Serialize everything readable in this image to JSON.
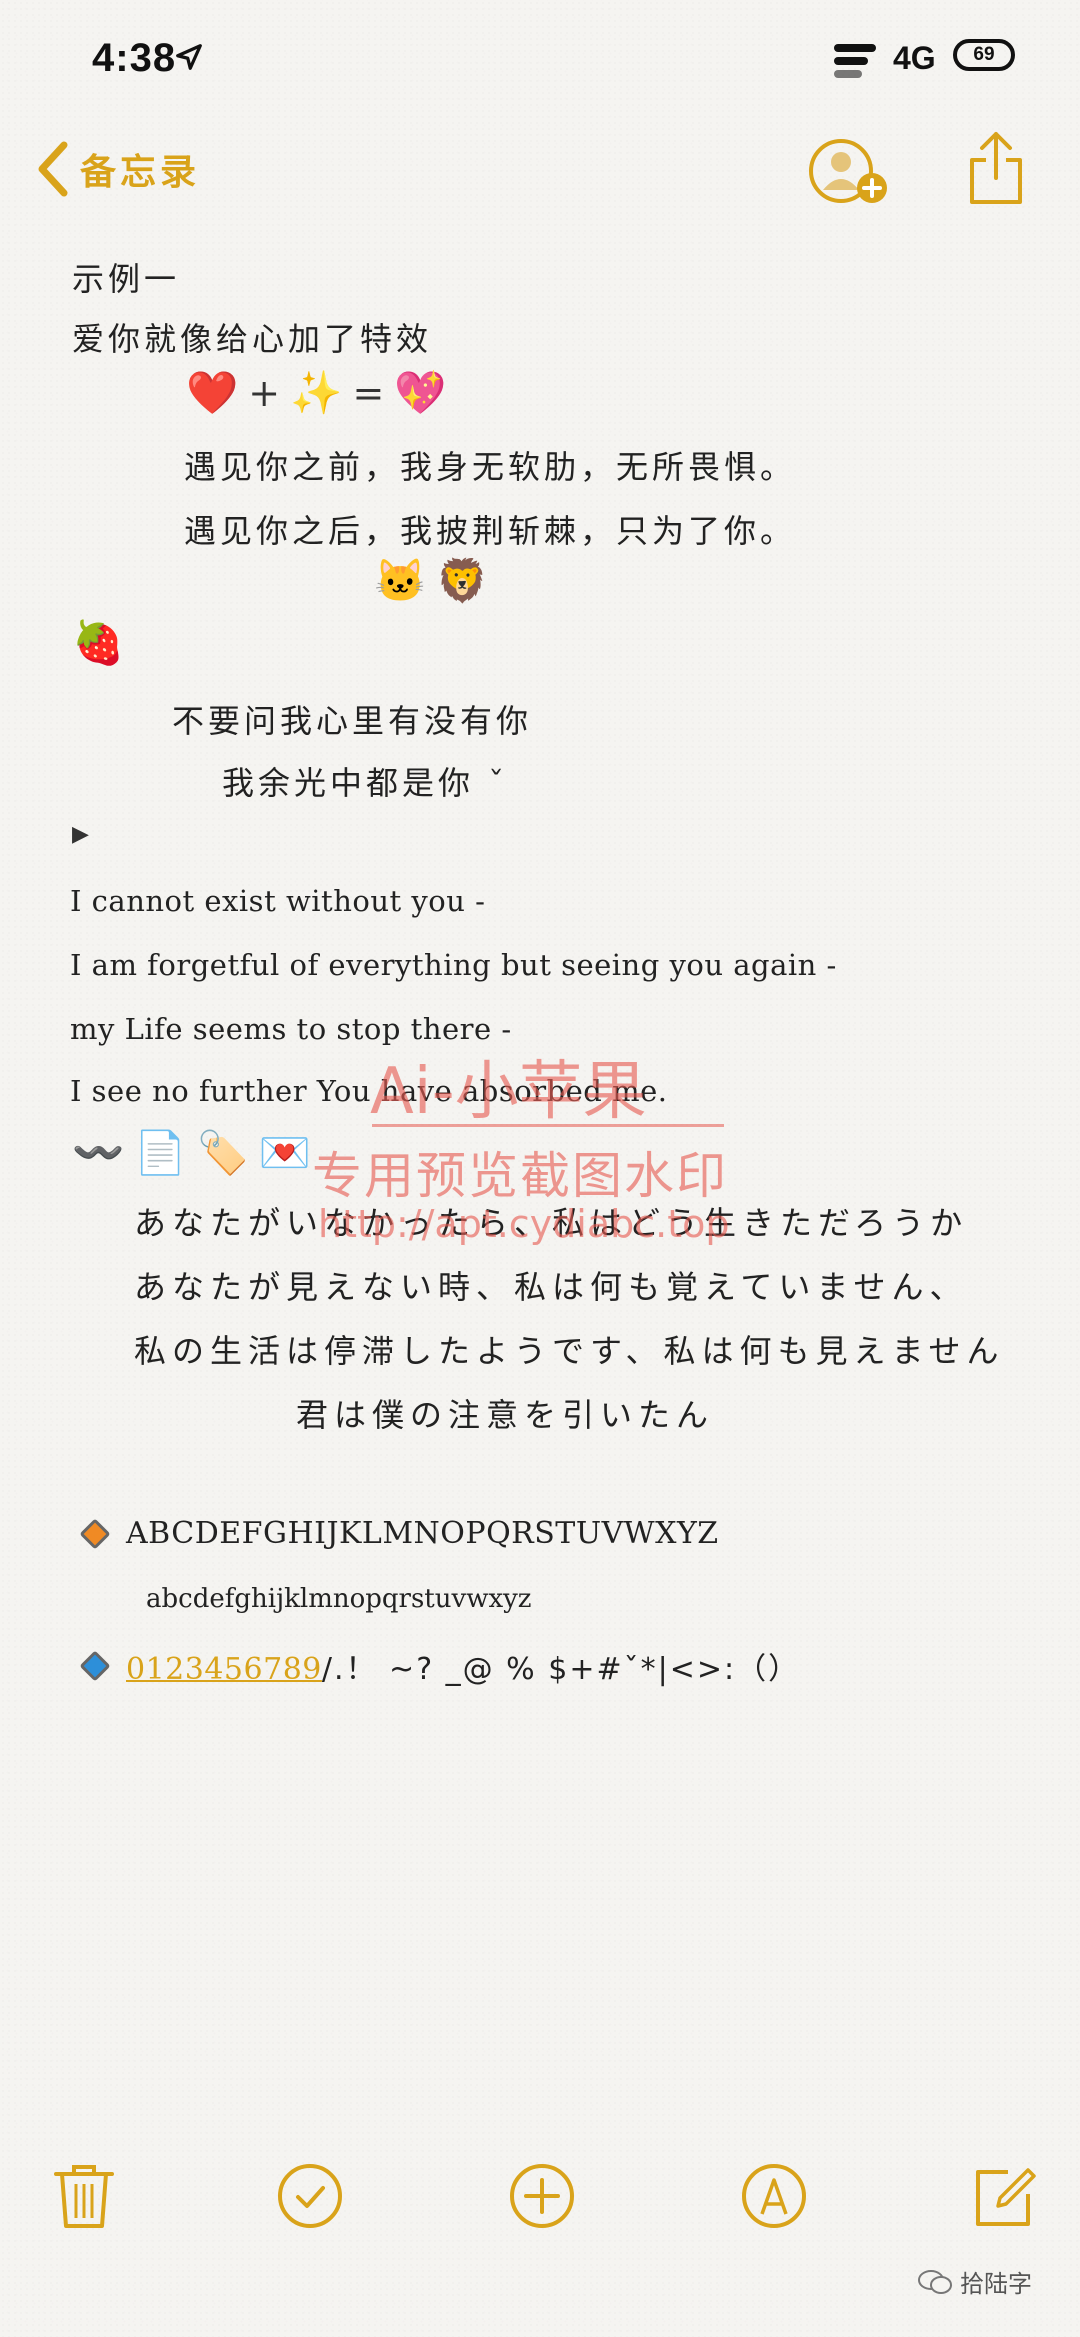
{
  "status_bar": {
    "time": "4:38",
    "network": "4G",
    "battery": "69"
  },
  "nav": {
    "back_label": "备忘录"
  },
  "note": {
    "example_title": "示例一",
    "line1": "爱你就像给心加了特效",
    "equation": {
      "a": "❤️",
      "plus": "+",
      "b": "✨",
      "eq": "=",
      "c": "💖"
    },
    "line2": "遇见你之前，我身无软肋，无所畏惧。",
    "line3": "遇见你之后，我披荆斩棘，只为了你。",
    "emoji_row1": [
      "🐱",
      "🦁"
    ],
    "strawberry": "🍓",
    "line4": "不要问我心里有没有你",
    "line5": "我余光中都是你 ˇ",
    "play": "▶",
    "en1": "I cannot exist without you -",
    "en2": "I am forgetful of everything but seeing you again -",
    "en3": "my Life seems to stop there -",
    "en4": "I see no further You have absorbed me.",
    "emoji_row2": [
      "〰️",
      "📄",
      "🏷️",
      "💌"
    ],
    "jp1": "あなたがいなかったら、私はどう生きただろうか",
    "jp2": "あなたが見えない時、私は何も覚えていません、",
    "jp3": "私の生活は停滞したようです、私は何も見えません",
    "jp4": "君は僕の注意を引いたん",
    "upper": "ABCDEFGHIJKLMNOPQRSTUVWXYZ",
    "lower": "abcdefghijklmnopqrstuvwxyz",
    "digits": "0123456789",
    "symbols": "/.！ ~? _@ % $+#ˇ*|<>:（）"
  },
  "watermark": {
    "line1": "Ai-小苹果",
    "line2": "专用预览截图水印",
    "line3": "http://apt.cydiabc.top"
  },
  "toolbar": {
    "icons": [
      "trash-icon",
      "checklist-icon",
      "add-icon",
      "markup-icon",
      "compose-icon"
    ]
  },
  "footer": {
    "wechat_label": "拾陆字"
  },
  "colors": {
    "accent": "#d9a31a",
    "watermark": "#e65a50"
  }
}
